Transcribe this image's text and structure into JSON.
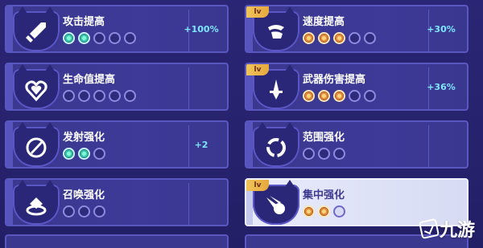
{
  "cards": [
    {
      "id": "attack",
      "name": "攻击提高",
      "value": "+100%",
      "dots": [
        "teal",
        "teal",
        "off",
        "off",
        "off"
      ],
      "tag": "",
      "icon": "sword-icon",
      "selected": false
    },
    {
      "id": "speed",
      "name": "速度提高",
      "value": "+30%",
      "dots": [
        "gold",
        "gold",
        "gold",
        "off",
        "off"
      ],
      "tag": "lv",
      "icon": "wing-foot-icon",
      "selected": false
    },
    {
      "id": "health",
      "name": "生命值提高",
      "value": "",
      "dots": [
        "off",
        "off",
        "off",
        "off",
        "off"
      ],
      "tag": "",
      "icon": "heart-icon",
      "selected": false
    },
    {
      "id": "weapon-damage",
      "name": "武器伤害提高",
      "value": "+36%",
      "dots": [
        "gold",
        "gold",
        "gold",
        "off",
        "off"
      ],
      "tag": "lv",
      "icon": "dagger-icon",
      "selected": false
    },
    {
      "id": "launch",
      "name": "发射强化",
      "value": "+2",
      "dots": [
        "teal",
        "teal",
        "off"
      ],
      "tag": "",
      "icon": "projectile-icon",
      "selected": false
    },
    {
      "id": "range",
      "name": "范围强化",
      "value": "",
      "dots": [
        "off",
        "off",
        "off"
      ],
      "tag": "",
      "icon": "ring-icon",
      "selected": false
    },
    {
      "id": "summon",
      "name": "召唤强化",
      "value": "",
      "dots": [
        "off",
        "off",
        "off"
      ],
      "tag": "",
      "icon": "summon-icon",
      "selected": false
    },
    {
      "id": "focus",
      "name": "集中强化",
      "value": "",
      "dots": [
        "gold",
        "gold",
        "off"
      ],
      "tag": "lv",
      "icon": "comet-icon",
      "selected": true
    }
  ],
  "watermark": {
    "text": "九游"
  },
  "colors": {
    "teal": "#35c6a6",
    "gold": "#e2883b",
    "panel": "#3b388f",
    "value": "#7fe6ff"
  }
}
